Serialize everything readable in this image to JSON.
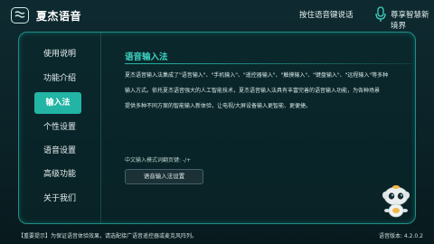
{
  "app": {
    "title": "夏杰语音",
    "voice_hint": "按住语音键说话",
    "slogan": "尊享智慧新境界"
  },
  "sidebar": {
    "items": [
      {
        "label": "使用说明",
        "active": false
      },
      {
        "label": "功能介绍",
        "active": false
      },
      {
        "label": "输入法",
        "active": true
      },
      {
        "label": "个性设置",
        "active": false
      },
      {
        "label": "语音设置",
        "active": false
      },
      {
        "label": "高级功能",
        "active": false
      },
      {
        "label": "关于我们",
        "active": false
      }
    ]
  },
  "content": {
    "title": "语音输入法",
    "desc_lines": [
      "夏杰语音输入法集成了\"语音输入\"、\"手机输入\"、\"遥控器输入\"、\"触摸输入\"、\"键盘输入\"、\"远程输入\"等多种",
      "输入方式。依托夏杰语音强大的人工智能技术，夏杰语音输入法具有丰富完善的语音输入功能，为各种场景",
      "提供多种不同方案的智能输入新体验，让电视/大屏设备输入更智能、更便捷。"
    ],
    "mode_text": "中文输入模式词翻页键: -/+",
    "settings_button": "语音输入法设置"
  },
  "footer": {
    "tip": "【重要提示】为保证语音体验效果，请选配接广语音遥控器或麦克风阵列。",
    "version": "语音版本: 4.2.0.2"
  },
  "colors": {
    "accent": "#22b4a4",
    "title": "#3fd3c2",
    "border": "#1e8f86"
  },
  "icons": {
    "logo": "speech-bubble-logo-icon",
    "mic": "microphone-icon",
    "mascot": "robot-mascot-icon"
  }
}
